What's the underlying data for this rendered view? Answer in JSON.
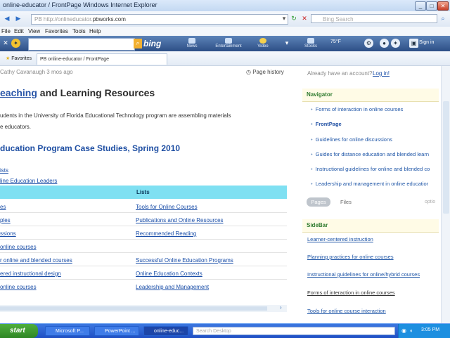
{
  "window": {
    "title": "online-educator / FrontPage   Windows Internet Explorer",
    "buttons": {
      "minimize": "_",
      "maximize": "□",
      "close": "✕"
    }
  },
  "address_bar": {
    "url_prefix": "PB  http://onlineducator.",
    "url_domain": "pbworks.com",
    "search_placeholder": "Bing Search"
  },
  "menu": [
    "File",
    "Edit",
    "View",
    "Favorites",
    "Tools",
    "Help"
  ],
  "bing_toolbar": {
    "logo": "bing",
    "items": [
      "News",
      "Entertainment",
      "Video",
      "Stocks"
    ],
    "weather": "75°F",
    "sign_in": "Sign in"
  },
  "favorites_bar": {
    "favorites_label": "Favorites",
    "tab_label": "PB online-educator / FrontPage"
  },
  "page": {
    "author_meta": "Cathy Cavanaugh  3 mos ago",
    "page_history": "Page history",
    "account_text": "Already have an account?",
    "login_link": "Log in!",
    "title_prefix": "eaching",
    "title_rest": " and Learning Resources",
    "intro_line1": "udents in the University of Florida Educational Technology program are assembling materials",
    "intro_line2": "e educators.",
    "subtitle": "ducation Program Case Studies, Spring 2010",
    "pre_table_links": [
      "ists",
      "line Education Leaders"
    ],
    "table_header": "Lists",
    "table_rows": [
      {
        "left": "es",
        "right": "Tools for Online Courses"
      },
      {
        "left": "ples",
        "right": "Publications and Online Resources"
      },
      {
        "left": "ssions",
        "right": "Recommended Reading"
      },
      {
        "left": " online courses",
        "right": ""
      },
      {
        "left": "r online and blended courses",
        "right": "Successful Online Education Programs"
      },
      {
        "left": "ered instructional design",
        "right": "Online Education Contexts"
      },
      {
        "left": " online courses",
        "right": "Leadership and Management"
      }
    ]
  },
  "navigator": {
    "heading": "Navigator",
    "items": [
      "Forms of interaction in online courses",
      "FrontPage",
      "Guidelines for online discussions",
      "Guides for distance education and blended learn",
      "Instructional guidelines for online and blended co",
      "Leadership and management in online educatior"
    ],
    "tabs": [
      "Pages",
      "Files"
    ],
    "options": "optio"
  },
  "sidebar": {
    "heading": "SideBar",
    "items": [
      "Learner-centered instruction",
      "Planning practices for online courses",
      "Instructional guidelines for online/hybrid courses",
      "Forms of interaction in online courses",
      "Tools for online course interaction"
    ]
  },
  "taskbar": {
    "start": "start",
    "tasks": [
      "Microsoft P...",
      "PowerPoint ...",
      "online-educ..."
    ],
    "search_placeholder": "Search Desktop",
    "clock": "3:05 PM"
  }
}
